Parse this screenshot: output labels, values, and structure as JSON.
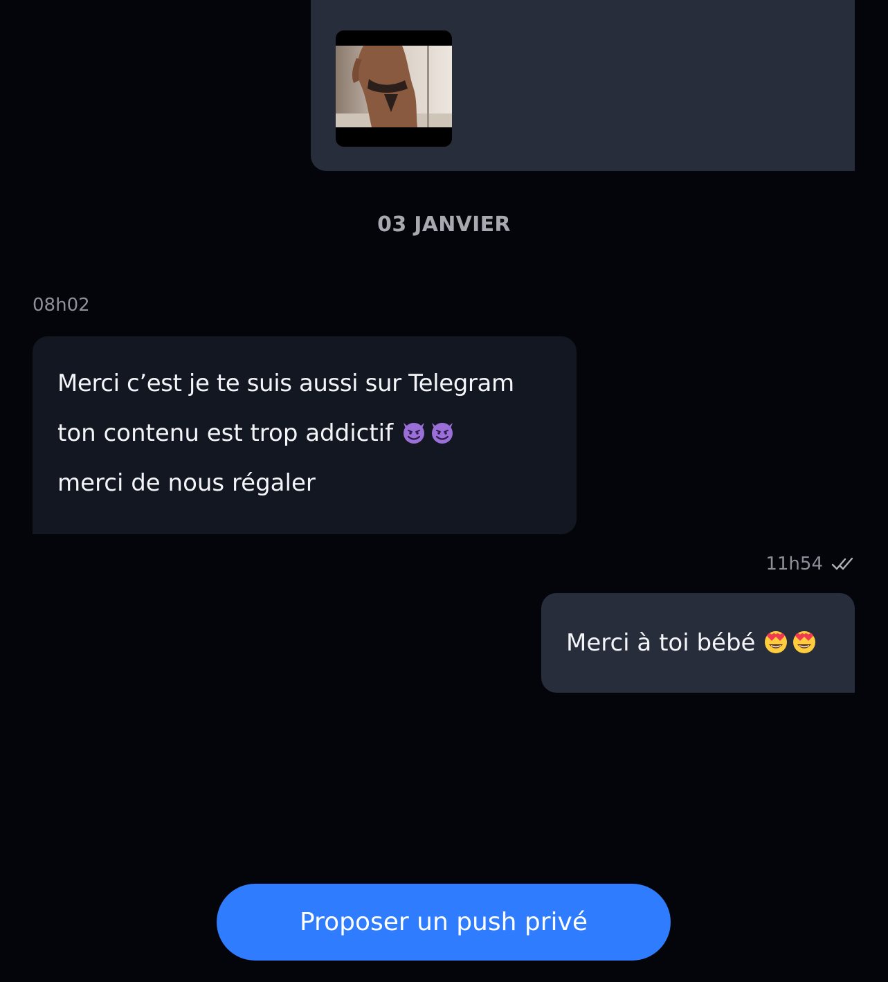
{
  "media_message": {
    "thumbnail_icon": "photo-thumbnail"
  },
  "date_separator": "03 JANVIER",
  "incoming_message": {
    "time": "08h02",
    "lines": [
      "Merci c’est je te suis aussi sur Telegram",
      "ton contenu est trop addictif",
      "merci de nous régaler"
    ],
    "emojis": [
      "smiling-devil-emoji",
      "smiling-devil-emoji"
    ]
  },
  "outgoing_message": {
    "time": "11h54",
    "status_icon": "double-check-icon",
    "text": "Merci à toi bébé",
    "emojis": [
      "heart-eyes-emoji",
      "heart-eyes-emoji"
    ]
  },
  "push_button": {
    "label": "Proposer un push privé"
  },
  "colors": {
    "background": "#04050a",
    "incoming_bubble": "#131722",
    "outgoing_bubble": "#282d3b",
    "accent": "#2f7cff",
    "muted_text": "#8e9099"
  }
}
